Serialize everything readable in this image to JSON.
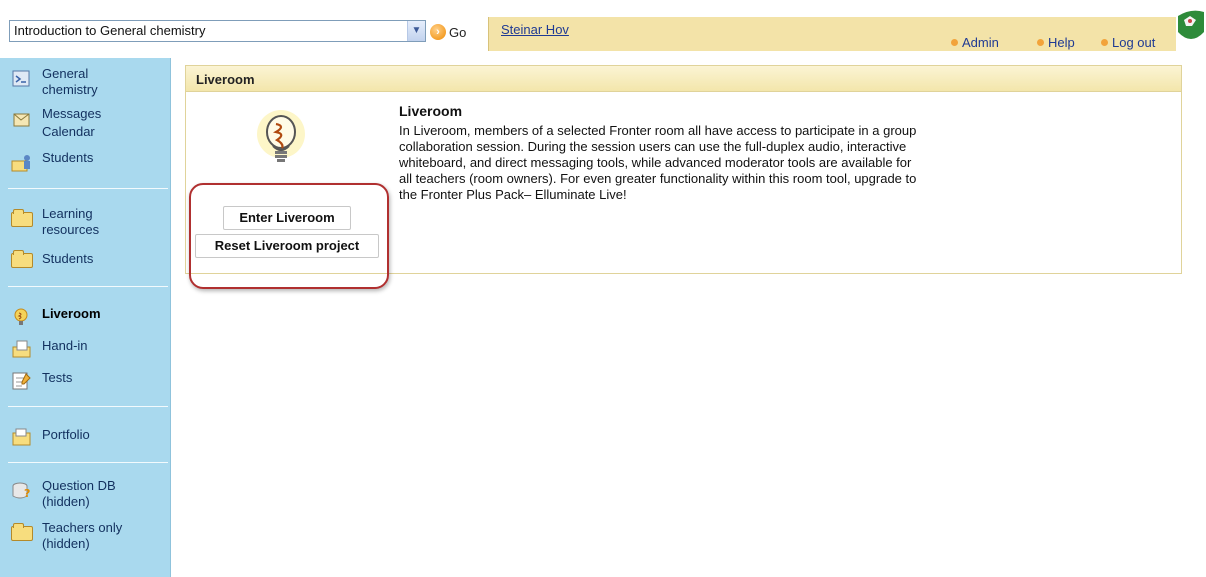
{
  "header": {
    "course_selected": "Introduction to General chemistry",
    "go_label": "Go",
    "username": "Steinar Hov",
    "links": {
      "admin": "Admin",
      "help": "Help",
      "logout": "Log out"
    }
  },
  "sidebar": {
    "items": [
      {
        "label": "General chemistry",
        "icon": "course-icon"
      },
      {
        "label": "Messages",
        "icon": "messages-icon"
      },
      {
        "label": "Calendar",
        "icon": "calendar-icon"
      },
      {
        "label": "Students",
        "icon": "students-icon"
      },
      {
        "label": "Learning resources",
        "icon": "folder-icon"
      },
      {
        "label": "Students",
        "icon": "folder-icon"
      },
      {
        "label": "Liveroom",
        "icon": "liveroom-icon",
        "active": true
      },
      {
        "label": "Hand-in",
        "icon": "hand-in-icon"
      },
      {
        "label": "Tests",
        "icon": "tests-icon"
      },
      {
        "label": "Portfolio",
        "icon": "portfolio-icon"
      },
      {
        "label": "Question DB (hidden)",
        "icon": "question-db-icon"
      },
      {
        "label": "Teachers only (hidden)",
        "icon": "folder-icon"
      }
    ]
  },
  "panel": {
    "header": "Liveroom",
    "title": "Liveroom",
    "description": "In Liveroom, members of a selected Fronter room all have access to participate in a group collaboration session. During the session users can use the full-duplex audio, interactive whiteboard, and direct messaging tools, while advanced moderator tools are available for all teachers (room owners). For even greater functionality within this room tool, upgrade to the Fronter Plus Pack– Elluminate Live!",
    "enter_button": "Enter Liveroom",
    "reset_button": "Reset Liveroom project"
  },
  "colors": {
    "sidebar_bg": "#a9d9ee",
    "userbar_bg": "#f3e3a8",
    "panel_header_bg": "#f3e6ab",
    "highlight_border": "#b03030",
    "link": "#1f3a93",
    "accent_dot": "#f2a33a"
  }
}
